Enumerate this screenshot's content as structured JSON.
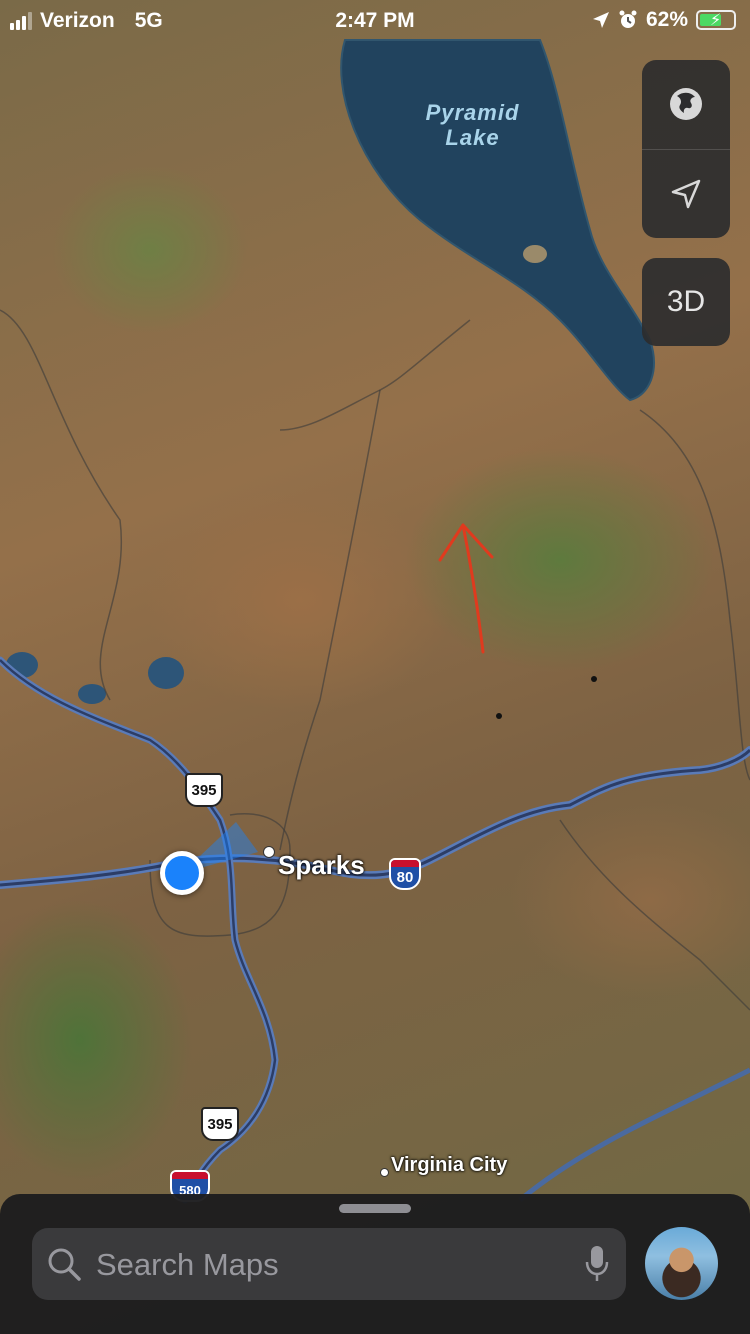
{
  "status_bar": {
    "carrier": "Verizon",
    "network": "5G",
    "time": "2:47 PM",
    "battery_percent": "62%",
    "battery_level": 0.62,
    "icons": [
      "location-arrow-icon",
      "alarm-icon",
      "charging-bolt-icon"
    ]
  },
  "map": {
    "labels": {
      "lake_line1": "Pyramid",
      "lake_line2": "Lake",
      "city_sparks": "Sparks",
      "city_virginia": "Virginia City"
    },
    "shields": {
      "us395_top": "395",
      "us395_bottom": "395",
      "i80": "80",
      "i580": "580"
    },
    "controls": {
      "map_mode_icon": "globe-icon",
      "locate_icon": "location-arrow-icon",
      "three_d_label": "3D"
    }
  },
  "bottom_sheet": {
    "search_placeholder": "Search Maps",
    "icons": [
      "search-icon",
      "microphone-icon",
      "avatar"
    ]
  },
  "colors": {
    "accent_blue": "#1a82fb",
    "lake_label": "#a9d4ea",
    "annotation_red": "#e03a1e",
    "sheet_bg": "#1c1c1e"
  }
}
